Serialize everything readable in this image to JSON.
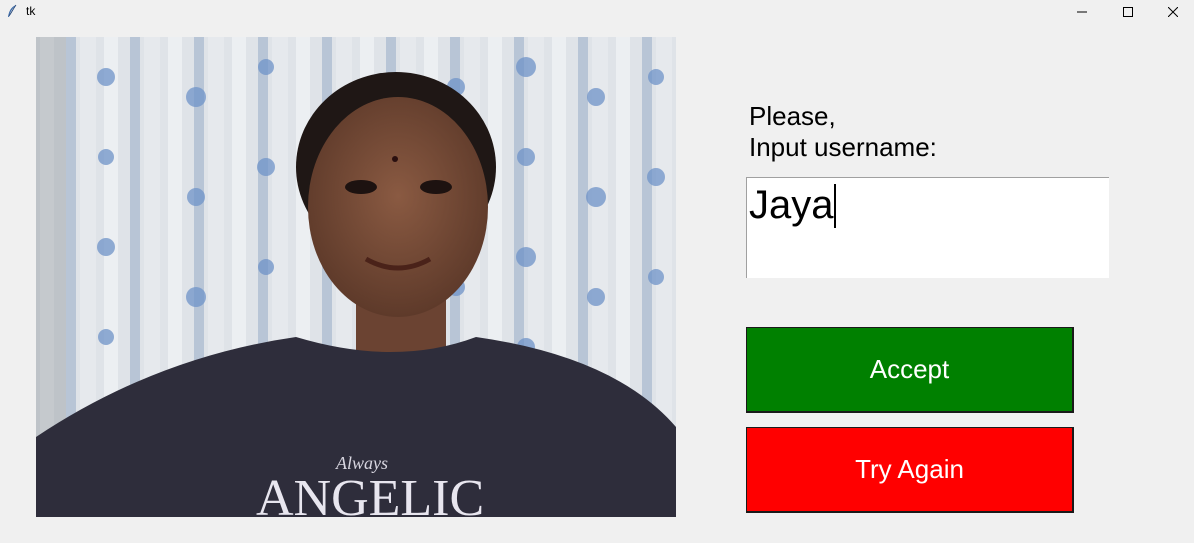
{
  "window": {
    "title": "tk",
    "icon": "feather-icon",
    "controls": [
      "minimize-icon",
      "maximize-icon",
      "close-icon"
    ]
  },
  "camera": {
    "shirt_text_small": "Always",
    "shirt_text_large": "ANGELIC"
  },
  "prompt": {
    "line1": "Please,",
    "line2": "Input username:"
  },
  "username": {
    "value": "Jaya"
  },
  "buttons": {
    "accept_label": "Accept",
    "retry_label": "Try Again"
  },
  "colors": {
    "accept": "#008000",
    "retry": "#ff0000",
    "background": "#f0f0f0"
  }
}
